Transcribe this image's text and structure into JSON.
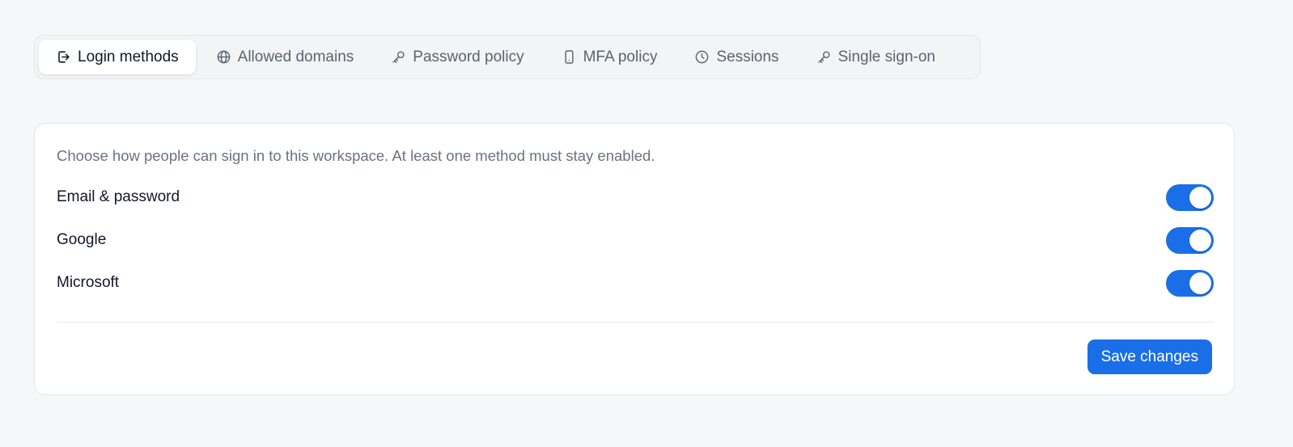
{
  "tabs": [
    {
      "label": "Login methods",
      "icon": "login-icon",
      "active": true
    },
    {
      "label": "Allowed domains",
      "icon": "globe-icon",
      "active": false
    },
    {
      "label": "Password policy",
      "icon": "key-icon",
      "active": false
    },
    {
      "label": "MFA policy",
      "icon": "phone-icon",
      "active": false
    },
    {
      "label": "Sessions",
      "icon": "clock-icon",
      "active": false
    },
    {
      "label": "Single sign-on",
      "icon": "key-icon",
      "active": false
    }
  ],
  "login_methods": {
    "description": "Choose how people can sign in to this workspace. At least one method must stay enabled.",
    "methods": [
      {
        "label": "Email & password",
        "enabled": true
      },
      {
        "label": "Google",
        "enabled": true
      },
      {
        "label": "Microsoft",
        "enabled": true
      }
    ],
    "save_label": "Save changes"
  },
  "colors": {
    "accent": "#1a6fe8",
    "background": "#f6f7f9",
    "card": "#ffffff",
    "border": "#e3e6ea",
    "muted_text": "#6b7280"
  }
}
